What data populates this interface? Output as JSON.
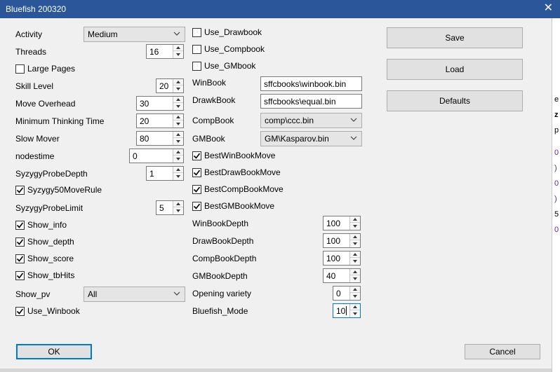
{
  "window": {
    "title": "Bluefish 200320",
    "close_glyph": "✕"
  },
  "left": {
    "activity_label": "Activity",
    "activity_value": "Medium",
    "threads_label": "Threads",
    "threads_value": "16",
    "large_pages_label": "Large Pages",
    "large_pages_checked": false,
    "skill_level_label": "Skill Level",
    "skill_level_value": "20",
    "move_overhead_label": "Move Overhead",
    "move_overhead_value": "30",
    "min_think_label": "Minimum Thinking Time",
    "min_think_value": "20",
    "slow_mover_label": "Slow Mover",
    "slow_mover_value": "80",
    "nodestime_label": "nodestime",
    "nodestime_value": "0",
    "syzygy_depth_label": "SyzygyProbeDepth",
    "syzygy_depth_value": "1",
    "syzygy50_label": "Syzygy50MoveRule",
    "syzygy50_checked": true,
    "syzygy_limit_label": "SyzygyProbeLimit",
    "syzygy_limit_value": "5",
    "show_info_label": "Show_info",
    "show_info_checked": true,
    "show_depth_label": "Show_depth",
    "show_depth_checked": true,
    "show_score_label": "Show_score",
    "show_score_checked": true,
    "show_tbhits_label": "Show_tbHits",
    "show_tbhits_checked": true,
    "show_pv_label": "Show_pv",
    "show_pv_value": "All",
    "use_winbook_label": "Use_Winbook",
    "use_winbook_checked": true
  },
  "middle": {
    "use_drawbook_label": "Use_Drawbook",
    "use_drawbook_checked": false,
    "use_compbook_label": "Use_Compbook",
    "use_compbook_checked": false,
    "use_gmbook_label": "Use_GMbook",
    "use_gmbook_checked": false,
    "winbook_label": "WinBook",
    "winbook_value": "sffcbooks\\winbook.bin",
    "drawkbook_label": "DrawkBook",
    "drawkbook_value": "sffcbooks\\equal.bin",
    "compbook_label": "CompBook",
    "compbook_value": "comp\\ccc.bin",
    "gmbook_label": "GMBook",
    "gmbook_value": "GM\\Kasparov.bin",
    "best_win_label": "BestWinBookMove",
    "best_win_checked": true,
    "best_draw_label": "BestDrawBookMove",
    "best_draw_checked": true,
    "best_comp_label": "BestCompBookMove",
    "best_comp_checked": true,
    "best_gm_label": "BestGMBookMove",
    "best_gm_checked": true,
    "winbook_depth_label": "WinBookDepth",
    "winbook_depth_value": "100",
    "drawbook_depth_label": "DrawBookDepth",
    "drawbook_depth_value": "100",
    "compbook_depth_label": "CompBookDepth",
    "compbook_depth_value": "100",
    "gmbook_depth_label": "GMBookDepth",
    "gmbook_depth_value": "40",
    "opening_variety_label": "Opening variety",
    "opening_variety_value": "0",
    "bluefish_mode_label": "Bluefish_Mode",
    "bluefish_mode_value": "10"
  },
  "buttons": {
    "save": "Save",
    "load": "Load",
    "defaults": "Defaults",
    "ok": "OK",
    "cancel": "Cancel"
  },
  "background_strip": [
    "e",
    "z",
    "p",
    "0",
    ")",
    "0",
    ")",
    "5",
    "0"
  ],
  "colors": {
    "titlebar": "#2b579a",
    "focus_border": "#0078d7",
    "dialog_bg": "#f0f0f0"
  },
  "icons": {
    "check": "checkmark-icon",
    "spin_up": "spin-up-icon",
    "spin_down": "spin-down-icon",
    "dropdown": "chevron-down-icon",
    "close": "close-icon"
  }
}
